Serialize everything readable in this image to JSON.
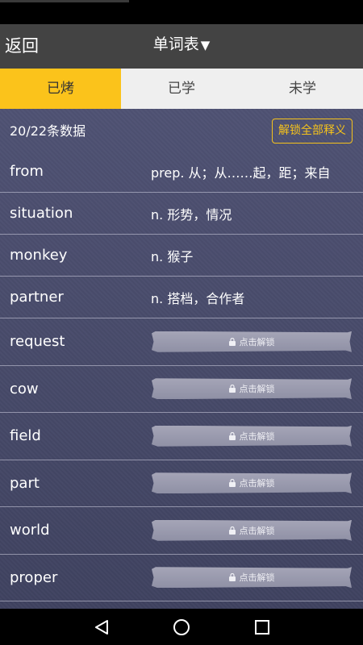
{
  "header": {
    "back_label": "返回",
    "title": "单词表",
    "title_caret": "▼"
  },
  "tabs": [
    {
      "label": "已烤",
      "active": true
    },
    {
      "label": "已学",
      "active": false
    },
    {
      "label": "未学",
      "active": false
    }
  ],
  "summary": {
    "count_text": "20/22条数据",
    "unlock_all_label": "解锁全部释义"
  },
  "words": [
    {
      "word": "from",
      "definition": "prep. 从；从……起，距；来自",
      "locked": false
    },
    {
      "word": "situation",
      "definition": "n. 形势，情况",
      "locked": false
    },
    {
      "word": "monkey",
      "definition": "n. 猴子",
      "locked": false
    },
    {
      "word": "partner",
      "definition": "n. 搭档，合作者",
      "locked": false
    },
    {
      "word": "request",
      "definition": "",
      "locked": true
    },
    {
      "word": "cow",
      "definition": "",
      "locked": true
    },
    {
      "word": "field",
      "definition": "",
      "locked": true
    },
    {
      "word": "part",
      "definition": "",
      "locked": true
    },
    {
      "word": "world",
      "definition": "",
      "locked": true
    },
    {
      "word": "proper",
      "definition": "",
      "locked": true
    }
  ],
  "lock_label": "点击解锁",
  "icons": {
    "lock": "lock-icon",
    "back": "triangle-back-icon",
    "home": "circle-home-icon",
    "recents": "square-recents-icon"
  },
  "colors": {
    "accent": "#fbc31b",
    "title_bar": "#434343",
    "list_bg": "#4a4d6d"
  }
}
